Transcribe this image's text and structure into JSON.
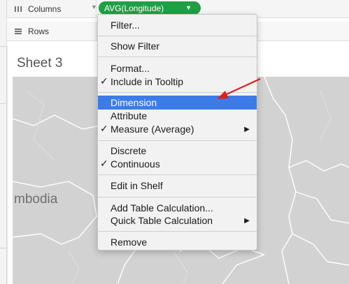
{
  "shelves": {
    "columns_label": "Columns",
    "columns_icon": "columns-icon",
    "rows_label": "Rows",
    "rows_icon": "rows-icon",
    "pill_label": "AVG(Longitude)",
    "pill_color": "#1fa045"
  },
  "sheet": {
    "title": "Sheet 3",
    "map_label": "mbodia"
  },
  "menu": {
    "items": [
      {
        "label": "Filter...",
        "checked": false,
        "submenu": false
      },
      {
        "label": "Show Filter",
        "checked": false,
        "submenu": false
      },
      {
        "label": "Format...",
        "checked": false,
        "submenu": false
      },
      {
        "label": "Include in Tooltip",
        "checked": true,
        "submenu": false
      },
      {
        "label": "Dimension",
        "checked": false,
        "submenu": false,
        "highlighted": true
      },
      {
        "label": "Attribute",
        "checked": false,
        "submenu": false
      },
      {
        "label": "Measure (Average)",
        "checked": true,
        "submenu": true
      },
      {
        "label": "Discrete",
        "checked": false,
        "submenu": false
      },
      {
        "label": "Continuous",
        "checked": true,
        "submenu": false
      },
      {
        "label": "Edit in Shelf",
        "checked": false,
        "submenu": false
      },
      {
        "label": "Add Table Calculation...",
        "checked": false,
        "submenu": false
      },
      {
        "label": "Quick Table Calculation",
        "checked": false,
        "submenu": true
      },
      {
        "label": "Remove",
        "checked": false,
        "submenu": false
      }
    ],
    "check_glyph": "✓",
    "submenu_glyph": "▶",
    "highlight_color": "#3d7ce8"
  },
  "annotation": {
    "arrow_color": "#e02020"
  }
}
